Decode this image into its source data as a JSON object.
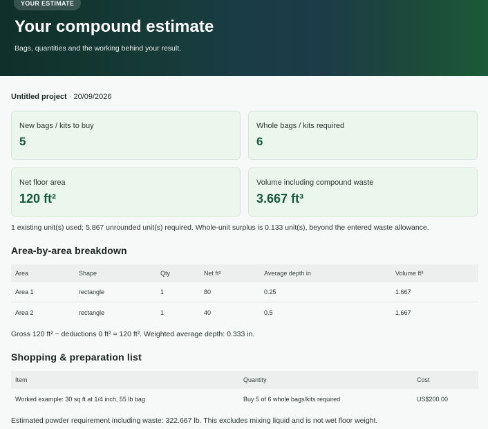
{
  "hero": {
    "badge": "YOUR ESTIMATE",
    "title": "Your compound estimate",
    "subtitle": "Bags, quantities and the working behind your result."
  },
  "meta": {
    "project": "Untitled project",
    "separator": "·",
    "date": "20/09/2026"
  },
  "cards": [
    {
      "label": "New bags / kits to buy",
      "value": "5"
    },
    {
      "label": "Whole bags / kits required",
      "value": "6"
    },
    {
      "label": "Net floor area",
      "value": "120 ft²"
    },
    {
      "label": "Volume including compound waste",
      "value": "3.667 ft³"
    }
  ],
  "units_note": "1 existing unit(s) used; 5.867 unrounded unit(s) required. Whole-unit surplus is 0.133 unit(s), beyond the entered waste allowance.",
  "areas": {
    "title": "Area-by-area breakdown",
    "headers": [
      "Area",
      "Shape",
      "Qty",
      "Net ft²",
      "Average depth in",
      "Volume ft³"
    ],
    "rows": [
      [
        "Area 1",
        "rectangle",
        "1",
        "80",
        "0.25",
        "1.667"
      ],
      [
        "Area 2",
        "rectangle",
        "1",
        "40",
        "0.5",
        "1.667"
      ]
    ],
    "summary": "Gross 120 ft² − deductions 0 ft² = 120 ft². Weighted average depth: 0.333 in."
  },
  "shopping": {
    "title": "Shopping & preparation list",
    "headers": [
      "Item",
      "Quantity",
      "Cost"
    ],
    "rows": [
      [
        "Worked example: 30 sq ft at 1/4 inch, 55 lb bag",
        "Buy 5 of 6 whole bags/kits required",
        "US$200.00"
      ]
    ],
    "footnote": "Estimated powder requirement including waste: 322.667 lb. This excludes mixing liquid and is not wet floor weight."
  },
  "colors": {
    "accent": "#17593a",
    "card_bg": "#ebf6ec",
    "hero_start": "#10302a",
    "hero_end": "#1b5a38"
  }
}
